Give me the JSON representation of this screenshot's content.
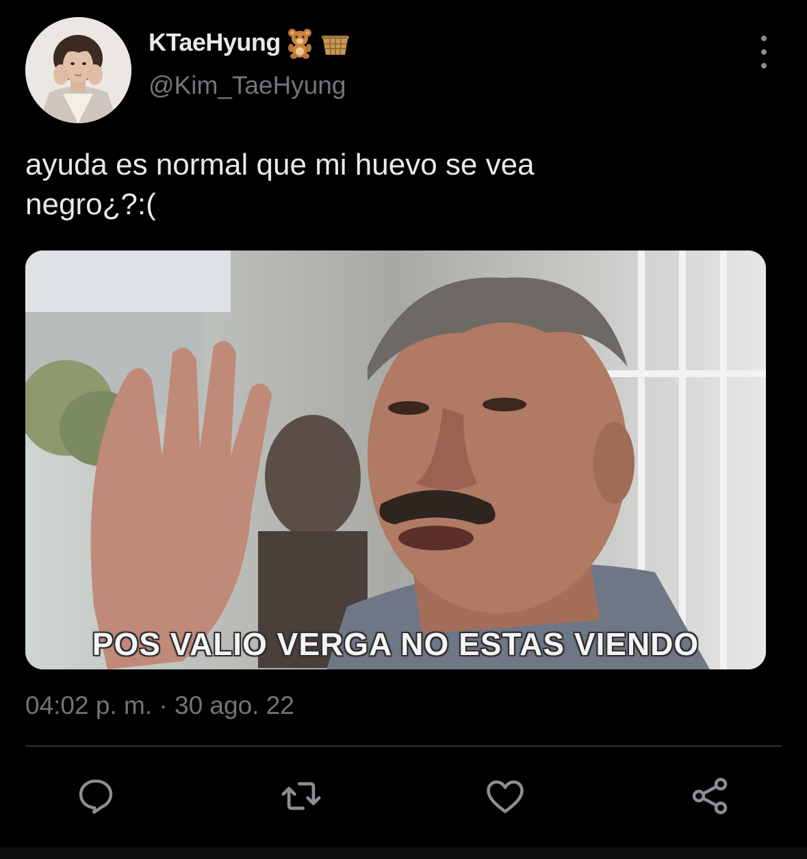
{
  "author": {
    "display_name": "KTaeHyung",
    "handle": "@Kim_TaeHyung",
    "badges": [
      "teddy-bear-emoji",
      "basket-emoji"
    ]
  },
  "tweet": {
    "text": "ayuda es normal que mi huevo se vea\nnegro¿?:("
  },
  "media": {
    "caption": "POS VALIO VERGA NO ESTAS VIENDO"
  },
  "meta": {
    "time": "04:02 p. m.",
    "separator": "·",
    "date": "30 ago. 22"
  },
  "actions": [
    "reply-icon",
    "retweet-icon",
    "like-icon",
    "share-icon"
  ],
  "colors": {
    "background": "#000000",
    "text": "#e7e9ea",
    "secondary_text": "#71767b",
    "divider": "#2f3336",
    "icon": "#8b8f94"
  }
}
